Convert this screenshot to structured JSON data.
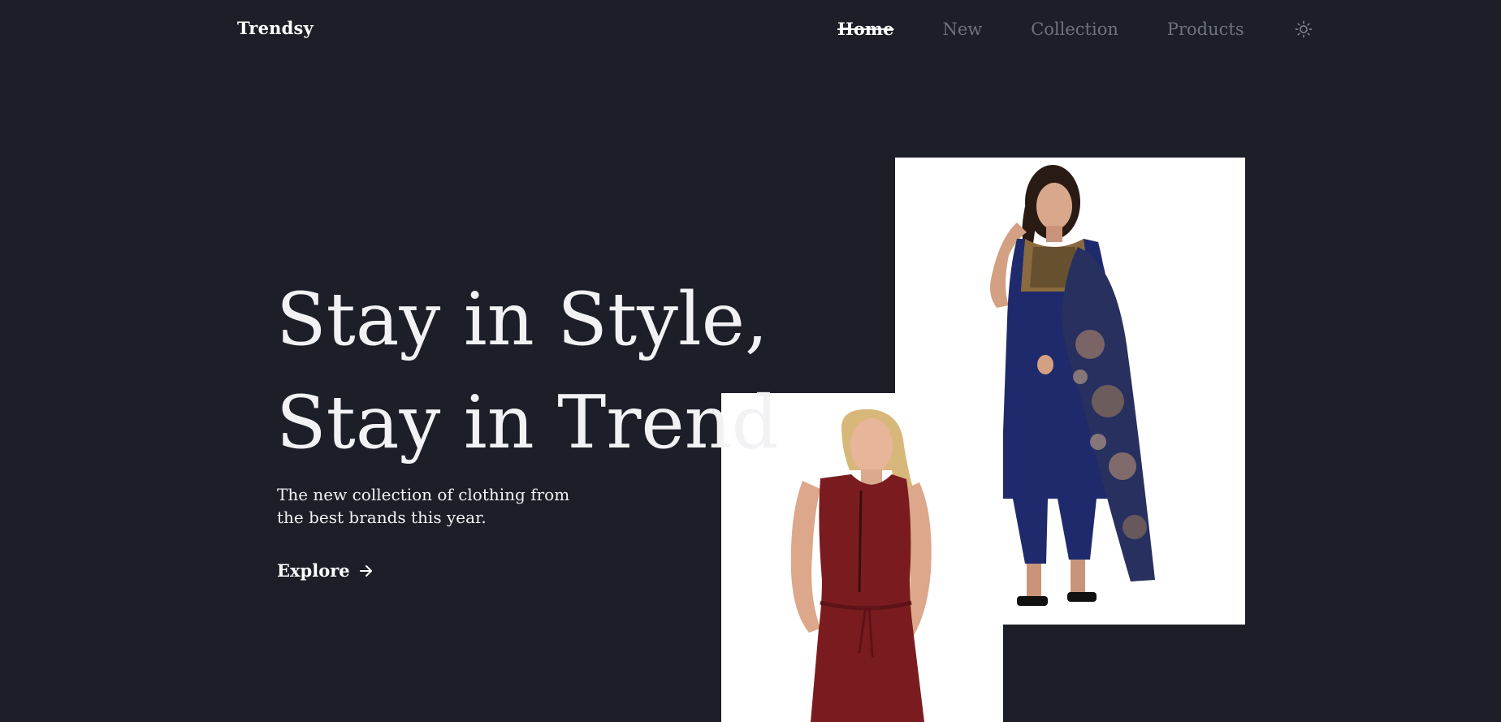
{
  "brand": {
    "name": "Trendsy"
  },
  "nav": {
    "items": [
      {
        "label": "Home",
        "active": true
      },
      {
        "label": "New",
        "active": false
      },
      {
        "label": "Collection",
        "active": false
      },
      {
        "label": "Products",
        "active": false
      }
    ],
    "theme_toggle_icon": "sun-icon"
  },
  "hero": {
    "headline_line1": "Stay in Style,",
    "headline_line2": "Stay in Trend",
    "subtitle": "The new collection of clothing from the best brands this year.",
    "cta_label": "Explore",
    "cta_icon": "arrow-right-icon"
  },
  "images": [
    {
      "name": "navy-kurta-model-photo"
    },
    {
      "name": "maroon-dress-model-photo"
    }
  ],
  "colors": {
    "background": "#1c1f27",
    "text_primary": "#f2f2f5",
    "nav_inactive": "#6f727c",
    "photo_background": "#ffffff"
  }
}
